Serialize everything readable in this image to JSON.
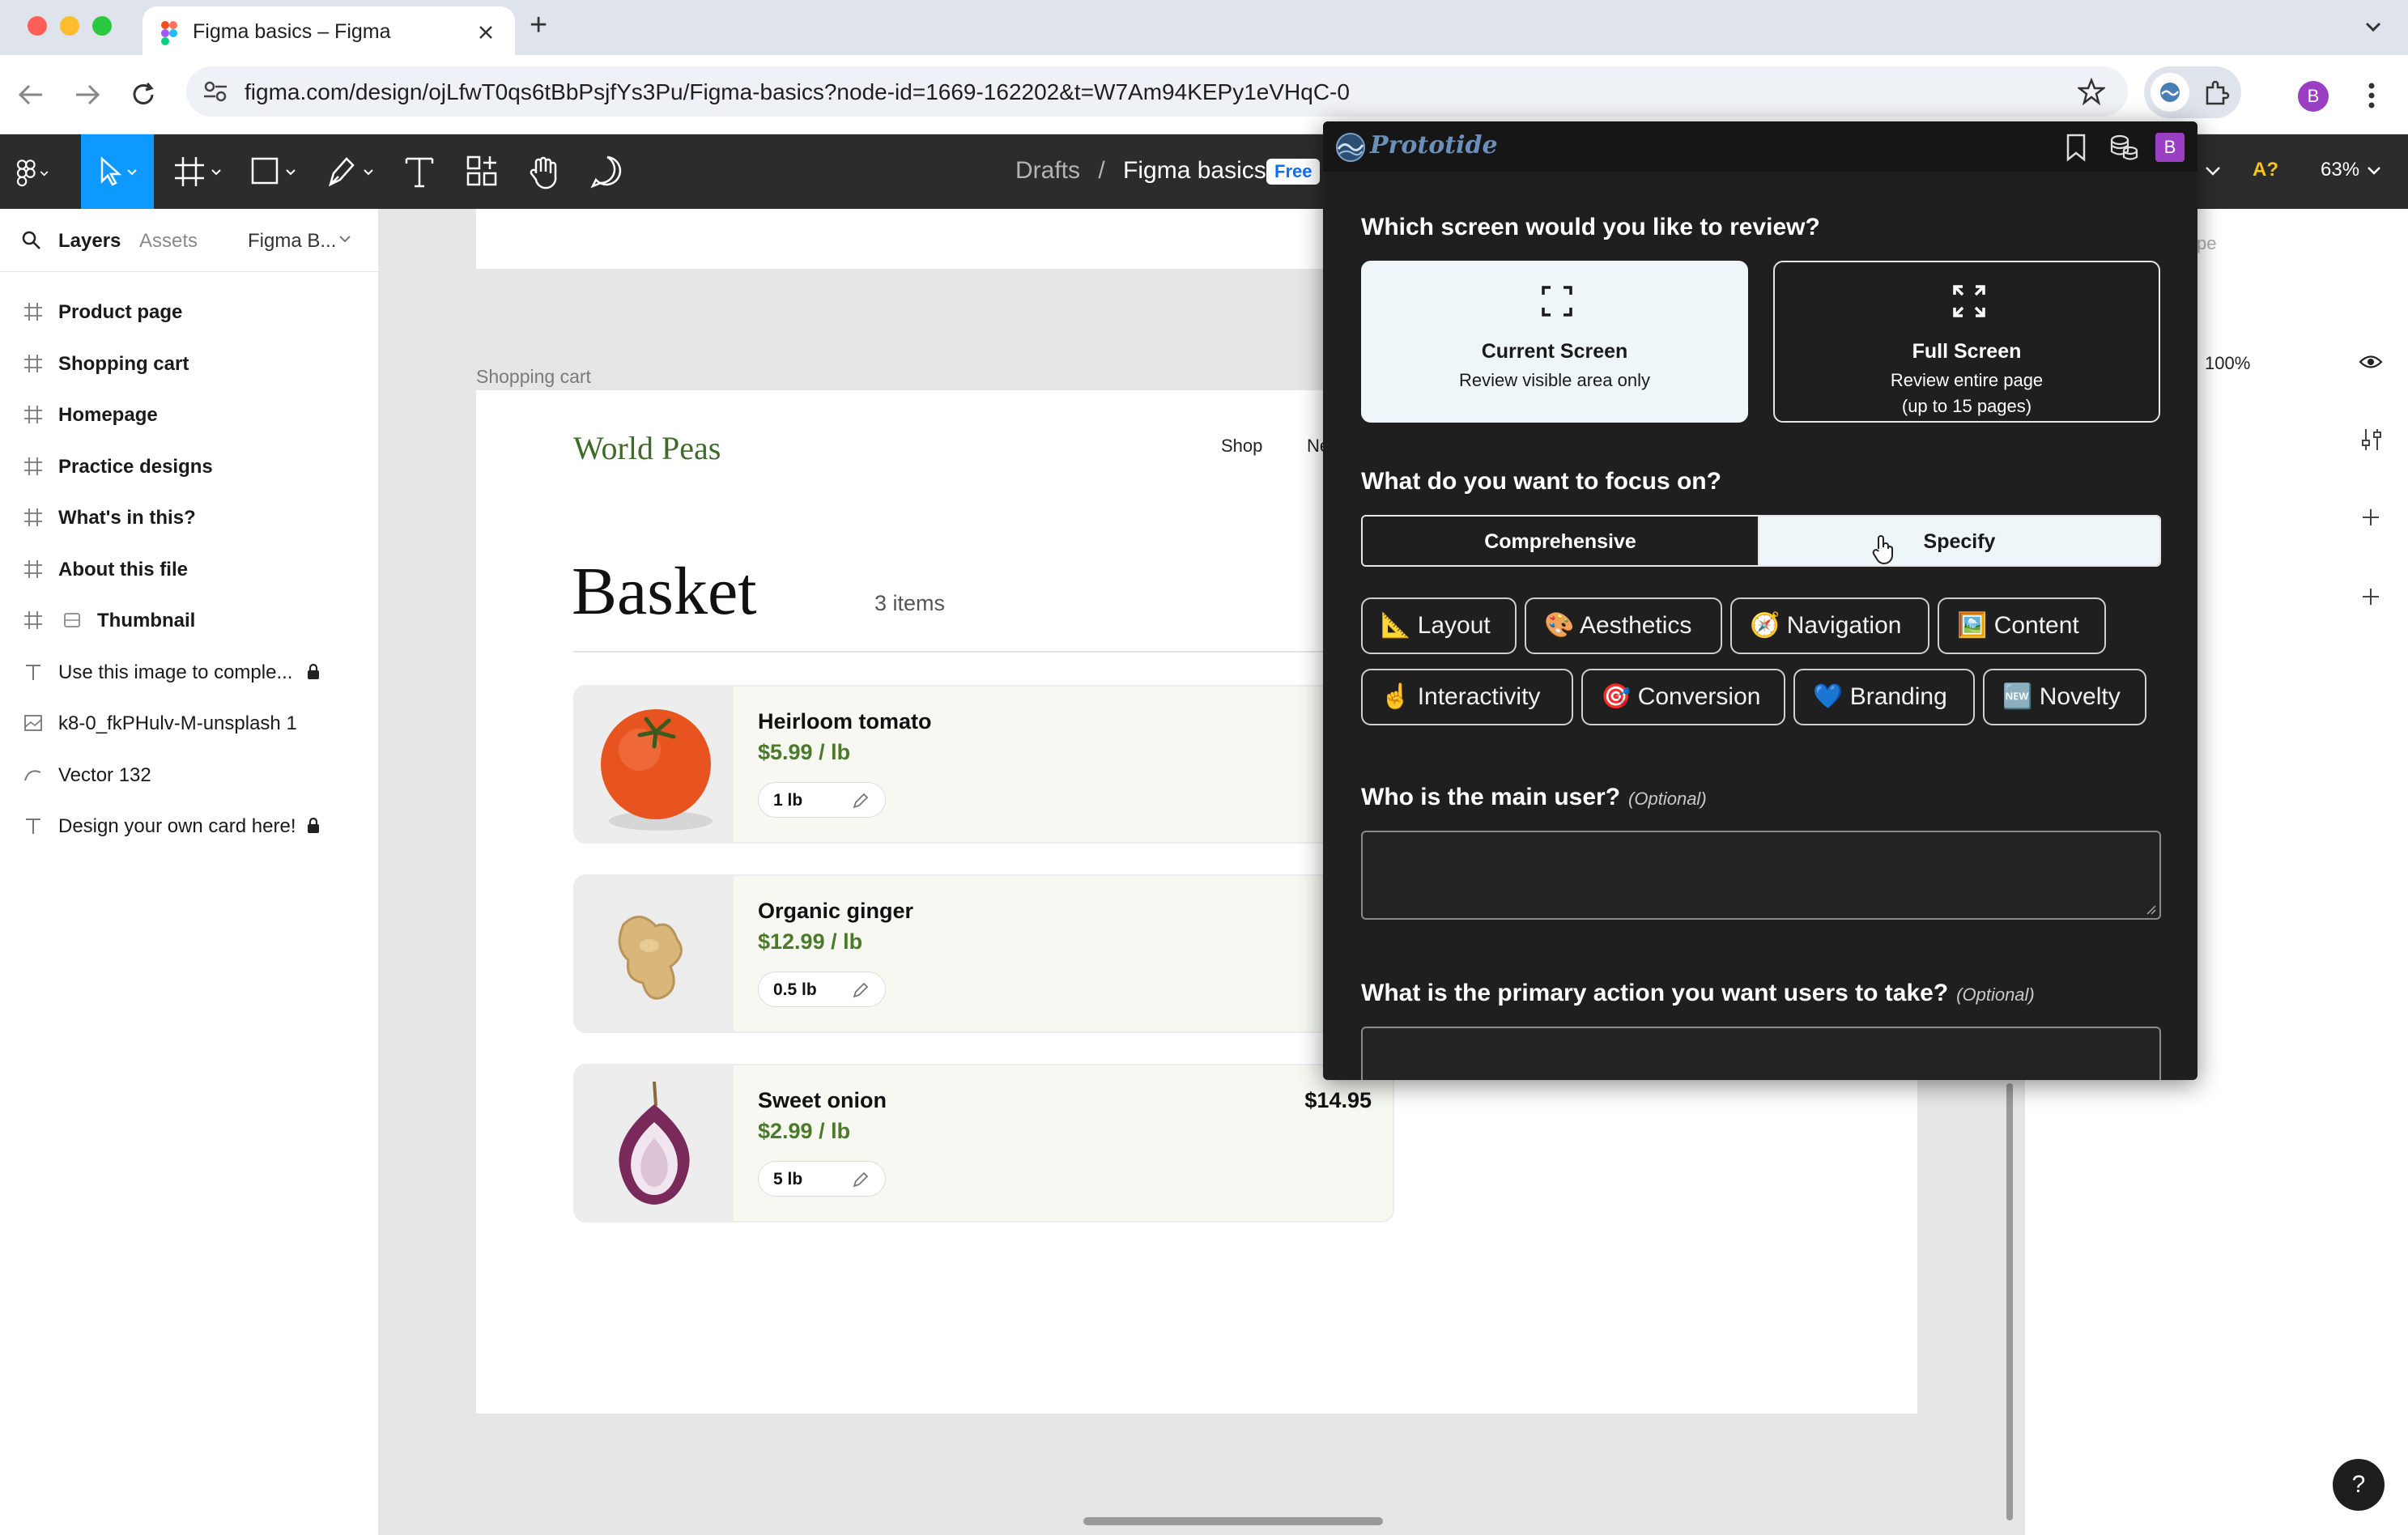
{
  "browser": {
    "tab_title": "Figma basics – Figma",
    "new_tab": "+",
    "url": "figma.com/design/ojLfwT0qs6tBbPsjfYs3Pu/Figma-basics?node-id=1669-162202&t=W7Am94KEPy1eVHqC-0",
    "profile_initial": "B"
  },
  "toolbar": {
    "breadcrumb_drafts": "Drafts",
    "breadcrumb_sep": "/",
    "file_name": "Figma basics",
    "plan_badge": "Free",
    "zoom": "63%",
    "font_warning": "A?"
  },
  "left_panel": {
    "tab_layers": "Layers",
    "tab_assets": "Assets",
    "page_name": "Figma B...",
    "layers": [
      {
        "name": "Product page",
        "icon": "frame-icon",
        "bold": true
      },
      {
        "name": "Shopping cart",
        "icon": "frame-icon",
        "bold": true
      },
      {
        "name": "Homepage",
        "icon": "frame-icon",
        "bold": true
      },
      {
        "name": "Practice designs",
        "icon": "frame-icon",
        "bold": true
      },
      {
        "name": "What's in this?",
        "icon": "frame-icon",
        "bold": true
      },
      {
        "name": "About this file",
        "icon": "frame-icon",
        "bold": true
      },
      {
        "name": "Thumbnail",
        "icon": "frame-icon",
        "bold": true
      },
      {
        "name": "Use this image to comple...",
        "icon": "text-icon",
        "bold": false
      },
      {
        "name": "k8-0_fkPHulv-M-unsplash 1",
        "icon": "image-icon",
        "bold": false
      },
      {
        "name": "Vector 132",
        "icon": "vector-icon",
        "bold": false
      },
      {
        "name": "Design your own card here!",
        "icon": "text-icon",
        "bold": false
      }
    ]
  },
  "canvas": {
    "frame_label": "Shopping cart",
    "brand": "World Peas",
    "nav_shop": "Shop",
    "nav_next": "Ne",
    "heading": "Basket",
    "item_count": "3 items",
    "cart_items": [
      {
        "name": "Heirloom tomato",
        "price": "$5.99 / lb",
        "qty": "1 lb",
        "total": "$"
      },
      {
        "name": "Organic ginger",
        "price": "$12.99 / lb",
        "qty": "0.5 lb",
        "total": "$"
      },
      {
        "name": "Sweet onion",
        "price": "$2.99 / lb",
        "qty": "5 lb",
        "total": "$14.95"
      }
    ]
  },
  "right_panel": {
    "partial_label": "pe",
    "opacity": "100%"
  },
  "prototide": {
    "logo": "Prototide",
    "avatar": "B",
    "q_screen": "Which screen would you like to review?",
    "screen_options": [
      {
        "title": "Current Screen",
        "subtitle": "Review visible area only",
        "selected": true
      },
      {
        "title": "Full Screen",
        "subtitle": "Review entire page",
        "subtitle2": "(up to 15 pages)",
        "selected": false
      }
    ],
    "q_focus": "What do you want to focus on?",
    "mode_comprehensive": "Comprehensive",
    "mode_specify": "Specify",
    "focus_chips": [
      "📐 Layout",
      "🎨 Aesthetics",
      "🧭 Navigation",
      "🖼️ Content",
      "☝️ Interactivity",
      "🎯 Conversion",
      "💙 Branding",
      "🆕 Novelty"
    ],
    "q_user": "Who is the main user?",
    "q_action": "What is the primary action you want users to take?",
    "optional": "(Optional)"
  },
  "help_label": "?",
  "colors": {
    "figma_toolbar": "#2c2c2c",
    "accent_blue": "#0d99ff",
    "popup_bg": "#1f1f1f",
    "selected_card": "#eef6fa",
    "price_green": "#4a7a2a",
    "brand_green": "#3f6b2a"
  }
}
